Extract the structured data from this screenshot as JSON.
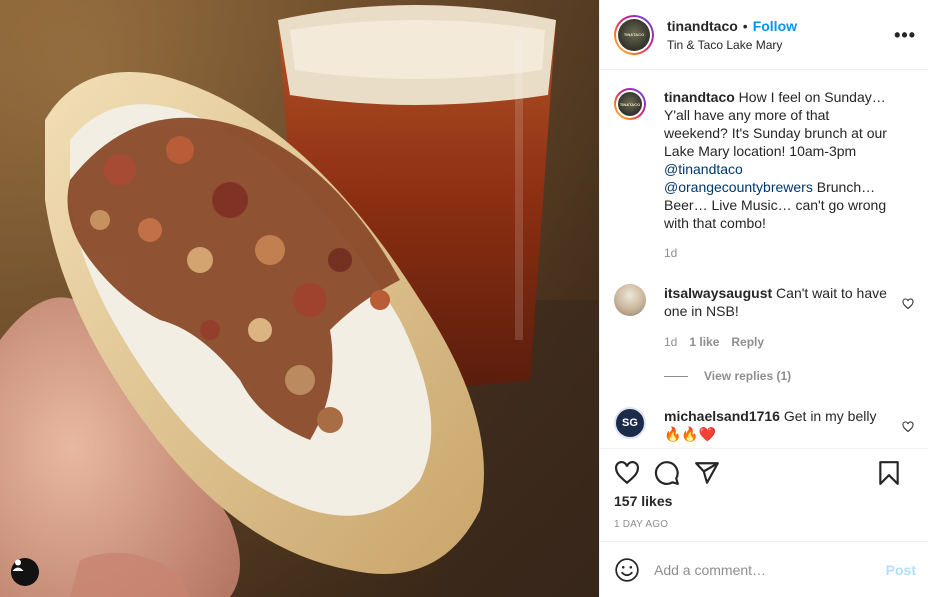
{
  "post": {
    "username": "tinandtaco",
    "separator": "•",
    "follow_label": "Follow",
    "location": "Tin & Taco Lake Mary",
    "more_label": "•••"
  },
  "caption": {
    "username": "tinandtaco",
    "text_part1": "How I feel on Sunday… Y'all have any more of that weekend? It's Sunday brunch at our Lake Mary location! 10am-3pm",
    "mention1": "@tinandtaco",
    "mention2": "@orangecountybrewers",
    "text_part2": "Brunch… Beer… Live Music… can't go wrong with that combo!",
    "time": "1d"
  },
  "comments": [
    {
      "username": "itsalwaysaugust",
      "text": "Can't wait to have one in NSB!",
      "time": "1d",
      "likes": "1 like",
      "reply": "Reply",
      "view_replies": "View replies (1)"
    },
    {
      "username": "michaelsand1716",
      "text": "Get in my belly",
      "emoji": "🔥🔥❤️"
    }
  ],
  "actions": {
    "likes": "157 likes",
    "ago": "1 DAY AGO"
  },
  "add_comment": {
    "placeholder": "Add a comment…",
    "post_label": "Post"
  },
  "icons": [
    "user-tag-icon",
    "more-options-icon",
    "like-heart-icon",
    "comment-icon",
    "share-icon",
    "bookmark-icon",
    "emoji-icon"
  ],
  "colors": {
    "follow": "#0095f6",
    "mention": "#00376b",
    "muted": "#8e8e8e",
    "post_disabled": "#b2dffc"
  }
}
